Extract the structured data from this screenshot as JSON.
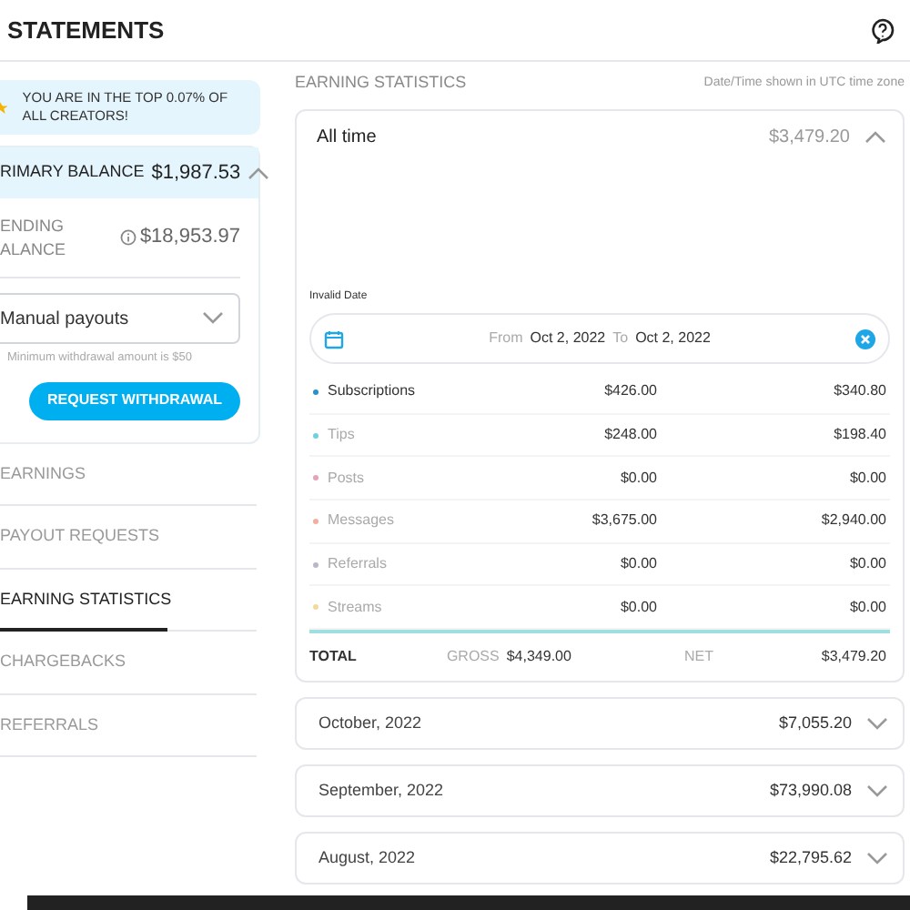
{
  "header": {
    "title": "STATEMENTS"
  },
  "banner": {
    "text": "YOU ARE IN THE TOP 0.07% OF ALL CREATORS!"
  },
  "balance": {
    "label": "RIMARY BALANCE",
    "amount": "$1,987.53",
    "expanded": true,
    "pending_label": "ENDING ALANCE",
    "pending_amount": "$18,953.97",
    "payout_select": "Manual payouts",
    "hint": "Minimum withdrawal amount is $50",
    "button": "REQUEST WITHDRAWAL"
  },
  "menu": [
    {
      "label": "EARNINGS",
      "selected": false
    },
    {
      "label": "PAYOUT REQUESTS",
      "selected": false
    },
    {
      "label": "EARNING STATISTICS",
      "selected": true
    },
    {
      "label": "CHARGEBACKS",
      "selected": false
    },
    {
      "label": "REFERRALS",
      "selected": false
    }
  ],
  "section": {
    "title": "EARNING STATISTICS",
    "note": "Date/Time shown in UTC time zone"
  },
  "all_time": {
    "title": "All time",
    "amount": "$3,479.20",
    "expanded": true,
    "date_label": "Invalid Date",
    "from_label": "From",
    "from": "Oct 2, 2022",
    "to_label": "To",
    "to": "Oct 2, 2022",
    "rows": [
      {
        "name": "Subscriptions",
        "color": "#2b8fc9",
        "highlighted": true,
        "gross": "$426.00",
        "net": "$340.80"
      },
      {
        "name": "Tips",
        "color": "#6fd0e0",
        "highlighted": false,
        "gross": "$248.00",
        "net": "$198.40"
      },
      {
        "name": "Posts",
        "color": "#e3a3b8",
        "highlighted": false,
        "gross": "$0.00",
        "net": "$0.00"
      },
      {
        "name": "Messages",
        "color": "#f0b0a0",
        "highlighted": false,
        "gross": "$3,675.00",
        "net": "$2,940.00"
      },
      {
        "name": "Referrals",
        "color": "#b8b8c8",
        "highlighted": false,
        "gross": "$0.00",
        "net": "$0.00"
      },
      {
        "name": "Streams",
        "color": "#f3d9a0",
        "highlighted": false,
        "gross": "$0.00",
        "net": "$0.00"
      }
    ],
    "total": {
      "label": "TOTAL",
      "gross_label": "GROSS",
      "gross": "$4,349.00",
      "net_label": "NET",
      "net": "$3,479.20"
    }
  },
  "months": [
    {
      "title": "October, 2022",
      "amount": "$7,055.20",
      "expanded": false
    },
    {
      "title": "September, 2022",
      "amount": "$73,990.08",
      "expanded": false
    },
    {
      "title": "August, 2022",
      "amount": "$22,795.62",
      "expanded": false
    }
  ]
}
